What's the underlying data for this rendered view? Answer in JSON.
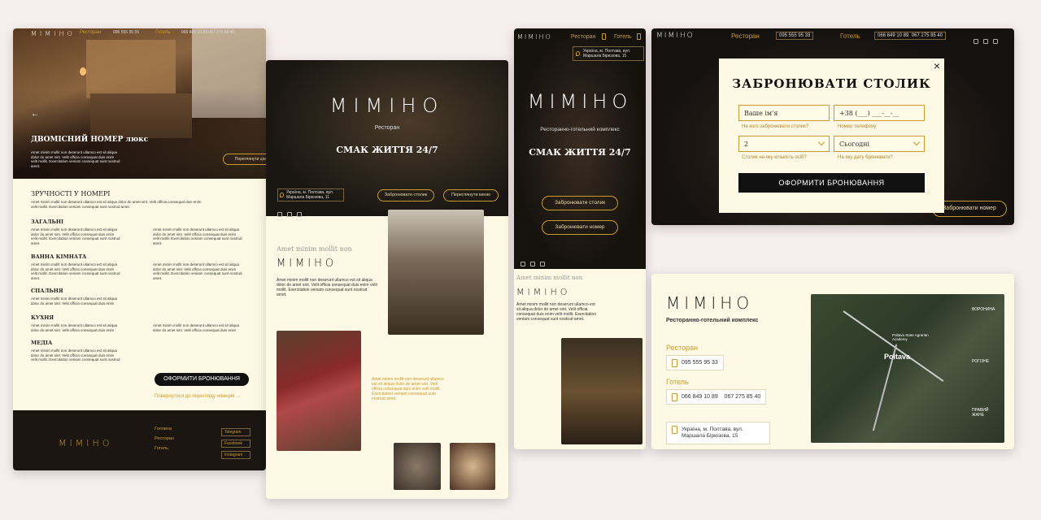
{
  "room": {
    "logo": "MIMIHO",
    "nav_restaurant": "Ресторан",
    "phone1": "095 555 95 55",
    "nav_hotel": "Готель",
    "phone2": "066 849 10 89",
    "phone3": "067 275 85 40",
    "title": "ДВОМІСНИЙ НОМЕР люкс",
    "lorem_short": "Amet minim mollit non deserunt ullamco est sit aliqua dolor do amet sint. Velit officia consequat duis enim velit mollit. Exercitation veniam consequat sunt nostrud amet.",
    "book_room": "Переглянути ціни",
    "amenities": "ЗРУЧНОСТІ У НОМЕРІ",
    "lorem": "Amet minim mollit non deserunt ullamco est sit aliqua dolor do amet sint. Velit officia consequat duis enim velit mollit. Exercitation veniam consequat sunt nostrud amet.",
    "sections": [
      "ЗАГАЛЬНІ",
      "ВАННА КІМНАТА",
      "СПАЛЬНЯ",
      "КУХНЯ",
      "МЕДІА"
    ],
    "cta": "ОФОРМИТИ БРОНЮВАННЯ",
    "back": "Повернутися до перегляду номерів →",
    "footer_logo": "MIMIHO",
    "footer_links": [
      "Головна",
      "Ресторан",
      "Готель"
    ],
    "social": [
      "Telegram",
      "Facebook",
      "Instagram"
    ]
  },
  "rest": {
    "logo": "MIMIHO",
    "sub": "Ресторан",
    "slogan": "СМАК ЖИТТЯ 24/7",
    "address": "Україна, м. Полтава, вул. Маршала Бірюзова, 11",
    "btn1": "Забронювати столик",
    "btn2": "Переглянути меню",
    "intro": "Amet minim mollit non",
    "logo2": "MIMIHO",
    "para": "Amet minim mollit non deserunt ullamco est sit aliqua dolor do amet sint. Velit officia consequat duis enim velit mollit. Exercitation veniam consequat sunt nostrud amet.",
    "para2": "Amet minim mollit non deserunt ullamco est sit aliqua dolor do amet sint. Velit officia consequat duis enim velit mollit. Exercitation veniam consequat sunt nostrud amet."
  },
  "mobile": {
    "logo": "MIMIHO",
    "nav_restaurant": "Ресторан",
    "nav_hotel": "Готель",
    "address": "Україна, м. Полтава, вул. Маршала Бірюзова, 15",
    "title": "MIMIHO",
    "sub": "Ресторанно-готельний комплекс",
    "slogan": "СМАК ЖИТТЯ 24/7",
    "btn1": "Забронювати столик",
    "btn2": "Забронювати номер",
    "intro": "Amet minim mollit non",
    "logo2": "MIMIHO",
    "para": "Amet minim mollit non deserunt ullamco est sit aliqua dolor do amet sint. Velit officia consequat duis enim velit mollit. Exercitation veniam consequat sunt nostrud amet."
  },
  "modal": {
    "logo": "MIMIHO",
    "nav_restaurant": "Ресторан",
    "phone1": "095 555 95 33",
    "nav_hotel": "Готель",
    "phone2": "066 849 10 89",
    "phone3": "067 275 85 40",
    "title": "ЗАБРОНЮВАТИ СТОЛИК",
    "name_ph": "Ваше ім'я",
    "phone_ph": "+38 (___) ___-__-__",
    "name_hint": "На кого забронювати столик?",
    "phone_hint": "Номер телефону",
    "guests": "2",
    "date": "Сьогодні",
    "guests_hint": "Столик на яку кількість осіб?",
    "date_hint": "На яку дату бронювати?",
    "submit": "ОФОРМИТИ БРОНЮВАННЯ",
    "bg_btn": "Забронювати номер",
    "close": "×"
  },
  "contacts": {
    "logo": "MIMIHO",
    "sub": "Ресторанно-готельний комплекс",
    "restaurant": "Ресторан",
    "phone_r": "095 555 95 33",
    "hotel": "Готель",
    "phone_h": "066 849 10 89    067 275 85 40",
    "address": "Україна, м. Полтава, вул. Маршала Бірюзова, 15",
    "map_city": "Poltava",
    "map_labels": [
      "Poltava State Agrarian Academy",
      "ВОРОНИНА",
      "РОГІЗНЕ",
      "ПРАВИЙ ЖАНЕ"
    ]
  }
}
